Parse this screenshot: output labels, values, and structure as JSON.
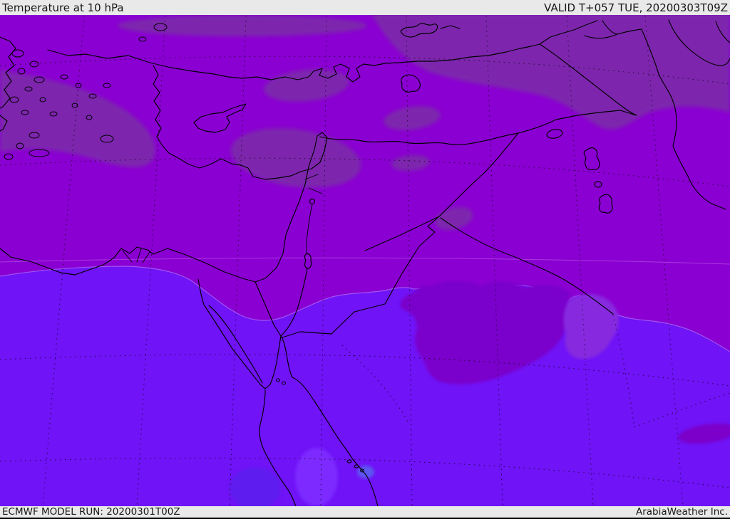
{
  "header": {
    "title": "Temperature at 10 hPa",
    "valid_label": "VALID T+057 TUE, 20200303T09Z"
  },
  "footer": {
    "model_run_label": "ECMWF MODEL RUN: 20200301T00Z",
    "brand_label": "ArabiaWeather Inc."
  },
  "map": {
    "kind": "temperature-contour-map",
    "region": "Middle East / Eastern Mediterranean",
    "colors": {
      "bar_background": "#e9e9e9",
      "bar_text": "#171717",
      "north_band": "#8a00d2",
      "north_muted_patch": "#7d26ad",
      "south_band": "#7013f7",
      "warm_blob_jordan": "#7a00cb",
      "patch_east_of_blob": "#8729df",
      "cool_blob_dark_blue": "#5e1aee",
      "cool_blob_light_blue": "#7b2cff",
      "cool_blob_tiny_blue": "#5b63f0",
      "southeast_dark_ellipse": "#7b00c9",
      "coastline": "#000000"
    }
  }
}
